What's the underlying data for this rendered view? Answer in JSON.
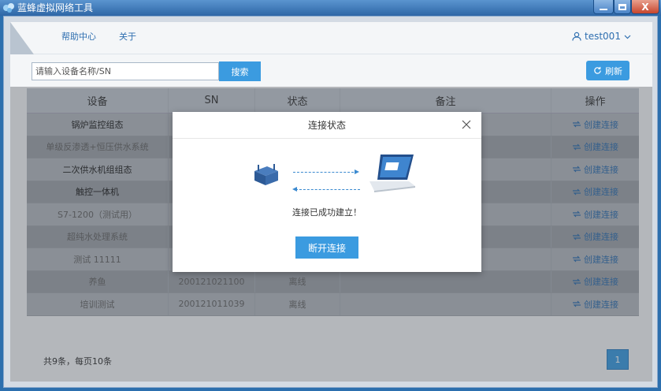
{
  "window": {
    "title": "蓝蜂虚拟网络工具",
    "min": "–",
    "max": "□",
    "close": "X"
  },
  "nav": {
    "help": "帮助中心",
    "about": "关于",
    "user": "test001"
  },
  "search": {
    "placeholder": "请输入设备名称/SN",
    "button": "搜索"
  },
  "refresh": {
    "label": "刷新"
  },
  "table": {
    "headers": [
      "设备",
      "SN",
      "状态",
      "备注",
      "操作"
    ],
    "rows": [
      {
        "name": "锅炉监控组态",
        "sn": "",
        "status": "",
        "note": "",
        "op": "创建连接",
        "online": true
      },
      {
        "name": "单级反渗透+恒压供水系统",
        "sn": "",
        "status": "",
        "note": "",
        "op": "创建连接",
        "online": false
      },
      {
        "name": "二次供水机组组态",
        "sn": "",
        "status": "",
        "note": "",
        "op": "创建连接",
        "online": true
      },
      {
        "name": "触控一体机",
        "sn": "",
        "status": "",
        "note": "",
        "op": "创建连接",
        "online": true
      },
      {
        "name": "S7-1200（测试用）",
        "sn": "",
        "status": "",
        "note": "",
        "op": "创建连接",
        "online": false
      },
      {
        "name": "超纯水处理系统",
        "sn": "",
        "status": "",
        "note": "",
        "op": "创建连接",
        "online": false
      },
      {
        "name": "测试 11111",
        "sn": "",
        "status": "",
        "note": "",
        "op": "创建连接",
        "online": false
      },
      {
        "name": "养鱼",
        "sn": "200121021100",
        "status": "离线",
        "note": "",
        "op": "创建连接",
        "online": false
      },
      {
        "name": "培训测试",
        "sn": "200121011039",
        "status": "离线",
        "note": "",
        "op": "创建连接",
        "online": false
      }
    ]
  },
  "footer": {
    "summary": "共9条，每页10条",
    "page": "1"
  },
  "modal": {
    "title": "连接状态",
    "message": "连接已成功建立！",
    "button": "断开连接"
  }
}
